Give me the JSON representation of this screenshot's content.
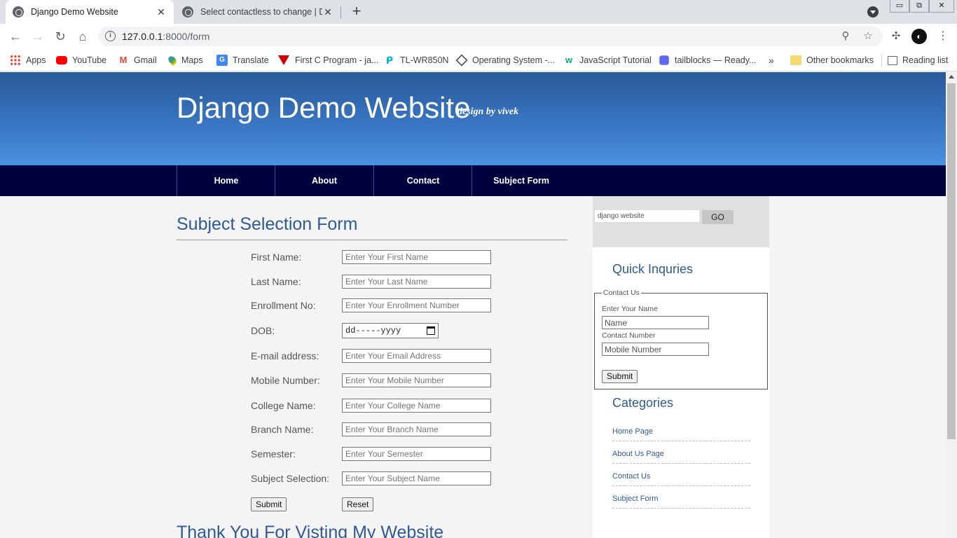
{
  "browser": {
    "tabs": [
      {
        "title": "Django Demo Website",
        "active": true
      },
      {
        "title": "Select contactless to change | Dja",
        "active": false
      }
    ],
    "url_host": "127.0.0.1",
    "url_path": ":8000/form",
    "win_controls": [
      "▭",
      "⧉",
      "✕"
    ],
    "bookmarks": [
      {
        "label": "Apps",
        "icon": "apps-grid-icon",
        "color": "#ea4335"
      },
      {
        "label": "YouTube",
        "icon": "youtube-icon",
        "color": "#ff0000"
      },
      {
        "label": "Gmail",
        "icon": "gmail-icon",
        "color": "#ea4335"
      },
      {
        "label": "Maps",
        "icon": "maps-pin-icon",
        "color": "#34a853"
      },
      {
        "label": "Translate",
        "icon": "translate-icon",
        "color": "#4285f4"
      },
      {
        "label": "First C Program - ja...",
        "icon": "javatpoint-icon",
        "color": "#d50000"
      },
      {
        "label": "TL-WR850N",
        "icon": "tplink-icon",
        "color": "#00b4d8"
      },
      {
        "label": "Operating System -...",
        "icon": "os-icon",
        "color": "#444444"
      },
      {
        "label": "JavaScript Tutorial",
        "icon": "w3schools-icon",
        "color": "#04aa6d"
      },
      {
        "label": "tailblocks — Ready...",
        "icon": "tailblocks-icon",
        "color": "#6366f1"
      }
    ],
    "bookmarks_overflow": "»",
    "other_bookmarks": "Other bookmarks",
    "reading_list": "Reading list"
  },
  "site": {
    "title": "Django Demo Website",
    "tagline": "design by vivek",
    "nav": [
      "Home",
      "About",
      "Contact",
      "Subject Form"
    ]
  },
  "form": {
    "heading": "Subject Selection Form",
    "fields": [
      {
        "label": "First Name:",
        "placeholder": "Enter Your First Name"
      },
      {
        "label": "Last Name:",
        "placeholder": "Enter Your Last Name"
      },
      {
        "label": "Enrollment No:",
        "placeholder": "Enter Your Enrollment Number"
      },
      {
        "label": "DOB:",
        "placeholder": "dd-----yyyy"
      },
      {
        "label": "E-mail address:",
        "placeholder": "Enter Your Email Address"
      },
      {
        "label": "Mobile Number:",
        "placeholder": "Enter Your Mobile Number"
      },
      {
        "label": "College Name:",
        "placeholder": "Enter Your College Name"
      },
      {
        "label": "Branch Name:",
        "placeholder": "Enter Your Branch Name"
      },
      {
        "label": "Semester:",
        "placeholder": "Enter Your Semester"
      },
      {
        "label": "Subject Selection:",
        "placeholder": "Enter Your Subject Name"
      }
    ],
    "submit_label": "Submit",
    "reset_label": "Reset",
    "footer_heading": "Thank You For Visting My Website"
  },
  "sidebar": {
    "search_value": "django website",
    "search_button": "GO",
    "quick_heading": "Quick Inquries",
    "contact_legend": "Contact Us",
    "name_label": "Enter Your Name",
    "name_placeholder": "Name",
    "contact_label": "Contact Number",
    "contact_placeholder": "Mobile Number",
    "submit_label": "Submit",
    "categories_heading": "Categories",
    "categories": [
      "Home Page",
      "About Us Page",
      "Contact Us",
      "Subject Form"
    ]
  }
}
